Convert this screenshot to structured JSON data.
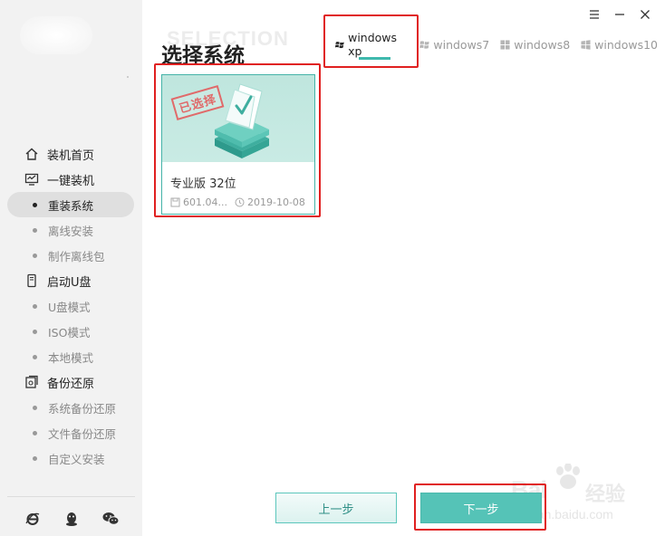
{
  "page": {
    "title": "选择系统",
    "bg_title": "SELECTION"
  },
  "tabs": [
    {
      "label": "windows xp",
      "active": true
    },
    {
      "label": "windows7",
      "active": false
    },
    {
      "label": "windows8",
      "active": false
    },
    {
      "label": "windows10",
      "active": false
    }
  ],
  "sidebar": {
    "groups": [
      {
        "label": "装机首页",
        "icon": "home-icon"
      },
      {
        "label": "一键装机",
        "icon": "monitor-icon"
      },
      {
        "label": "启动U盘",
        "icon": "usb-icon"
      },
      {
        "label": "备份还原",
        "icon": "backup-icon"
      }
    ],
    "items": [
      {
        "label": "重装系统",
        "active": true
      },
      {
        "label": "离线安装"
      },
      {
        "label": "制作离线包"
      },
      {
        "label": "U盘模式"
      },
      {
        "label": "ISO模式"
      },
      {
        "label": "本地模式"
      },
      {
        "label": "系统备份还原"
      },
      {
        "label": "文件备份还原"
      },
      {
        "label": "自定义安装"
      }
    ],
    "footer_icons": [
      "ie-icon",
      "qq-icon",
      "wechat-icon"
    ]
  },
  "card": {
    "stamp": "已选择",
    "name": "专业版 32位",
    "size": "601.04...",
    "date": "2019-10-08"
  },
  "buttons": {
    "prev": "上一步",
    "next": "下一步"
  },
  "watermark": {
    "logo": "Bai",
    "cn": "经验",
    "url": "jingyan.baidu.com"
  },
  "colors": {
    "accent": "#55c3b7",
    "highlight": "#e02020",
    "sidebar_bg": "#f2f2f2"
  }
}
